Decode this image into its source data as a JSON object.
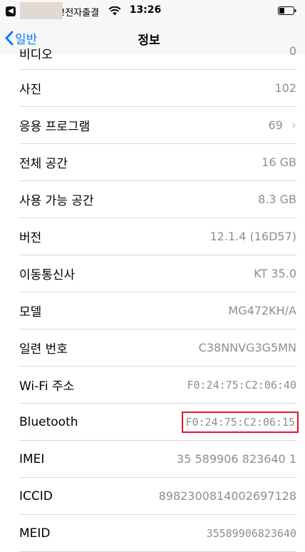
{
  "status_bar": {
    "carrier": "!전자출결",
    "time": "13:26"
  },
  "nav": {
    "back_label": "일반",
    "title": "정보"
  },
  "rows": [
    {
      "label": "비디오",
      "value": "0"
    },
    {
      "label": "사진",
      "value": "102"
    },
    {
      "label": "응용 프로그램",
      "value": "69"
    },
    {
      "label": "전체 공간",
      "value": "16 GB"
    },
    {
      "label": "사용 가능 공간",
      "value": "8.3 GB"
    },
    {
      "label": "버전",
      "value": "12.1.4 (16D57)"
    },
    {
      "label": "이동통신사",
      "value": "KT 35.0"
    },
    {
      "label": "모델",
      "value": "MG472KH/A"
    },
    {
      "label": "일련 번호",
      "value": "C38NNVG3G5MN"
    },
    {
      "label": "Wi-Fi 주소",
      "value": "F0:24:75:C2:06:40"
    },
    {
      "label": "Bluetooth",
      "value": "F0:24:75:C2:06:15"
    },
    {
      "label": "IMEI",
      "value": "35 589906 823640 1"
    },
    {
      "label": "ICCID",
      "value": "8982300814002697128"
    },
    {
      "label": "MEID",
      "value": "35589906823640"
    }
  ],
  "colors": {
    "accent": "#007aff",
    "highlight": "#e8112d",
    "secondary_text": "#8e8e93"
  }
}
